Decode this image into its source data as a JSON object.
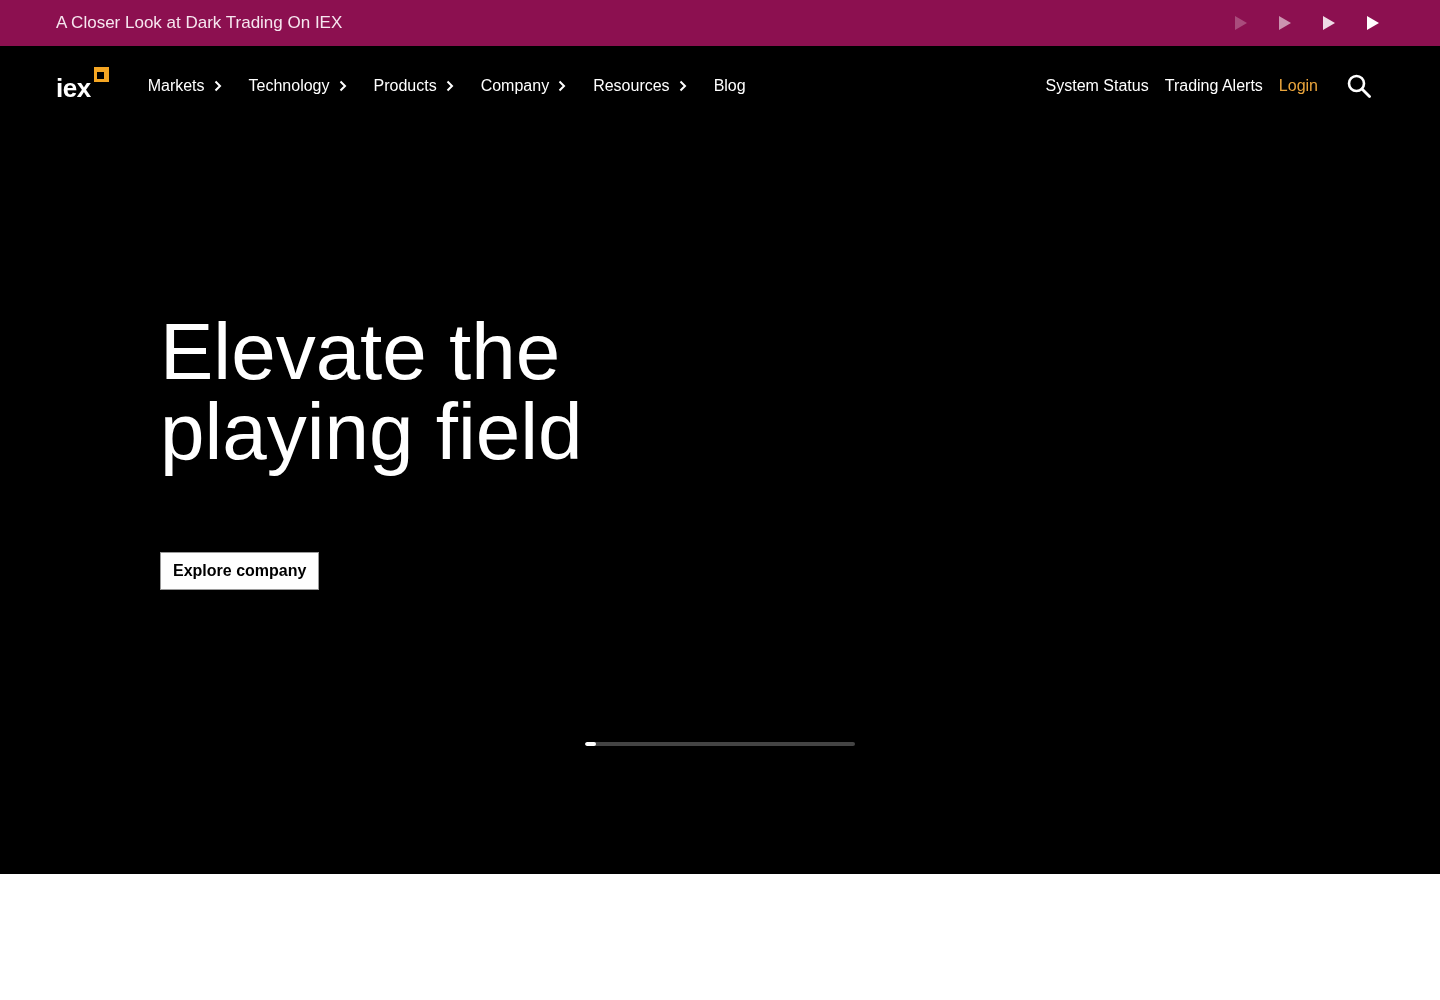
{
  "announcement": {
    "text": "A Closer Look at Dark Trading On IEX"
  },
  "header": {
    "logo": "iex",
    "nav": [
      {
        "label": "Markets",
        "has_submenu": true
      },
      {
        "label": "Technology",
        "has_submenu": true
      },
      {
        "label": "Products",
        "has_submenu": true
      },
      {
        "label": "Company",
        "has_submenu": true
      },
      {
        "label": "Resources",
        "has_submenu": true
      },
      {
        "label": "Blog",
        "has_submenu": false
      }
    ],
    "utility_links": [
      {
        "label": "System Status",
        "kind": "link"
      },
      {
        "label": "Trading Alerts",
        "kind": "link"
      },
      {
        "label": "Login",
        "kind": "login"
      }
    ]
  },
  "hero": {
    "headline": "Elevate the playing field",
    "button": "Explore company",
    "slider": {
      "level": 0.04
    }
  }
}
